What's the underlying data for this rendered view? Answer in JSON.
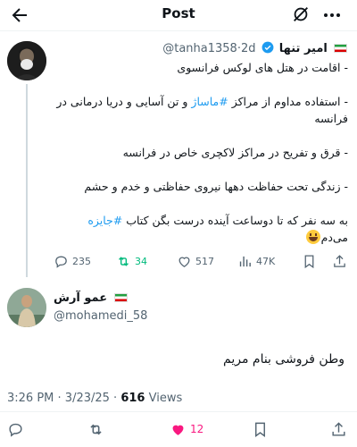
{
  "header": {
    "title": "Post"
  },
  "quoted_tweet": {
    "author_name": "امیر تنها",
    "handle": "@tanha1358",
    "separator": "·",
    "time": "2d",
    "lines": [
      "- اقامت در هتل های لوکس فرانسوی",
      "- استفاده مداوم از مراکز",
      "#ماساژ",
      "و تن آسایی و دریا درمانی در فرانسه",
      "- قرق و تفریح در مراکز لاکچری خاص در فرانسه",
      "- زندگی تحت حفاظت دهها نیروی حفاظتی و خدم و حشم",
      "به سه نفر که تا دوساعت آینده درست بگن کتاب",
      "#جایزه",
      "می‌دم"
    ],
    "stats": {
      "replies": "235",
      "retweets": "34",
      "likes": "517",
      "views": "47K"
    }
  },
  "main_tweet": {
    "author_name": "عمو آرش",
    "handle": "@mohamedi_58",
    "text": "وطن فروشی بنام مریم",
    "time": "3:26 PM",
    "date": "3/23/25",
    "views_count": "616",
    "views_label": "Views",
    "likes": "12"
  },
  "colors": {
    "accent": "#1d9bf0",
    "retweet": "#00ba7c",
    "like": "#f91880",
    "muted": "#536471"
  },
  "icons": [
    "back-arrow-icon",
    "mute-icon",
    "more-icon",
    "verified-badge-icon",
    "iran-flag-icon",
    "reply-icon",
    "retweet-icon",
    "like-icon",
    "views-icon",
    "bookmark-icon",
    "share-icon",
    "grinning-emoji-icon"
  ]
}
